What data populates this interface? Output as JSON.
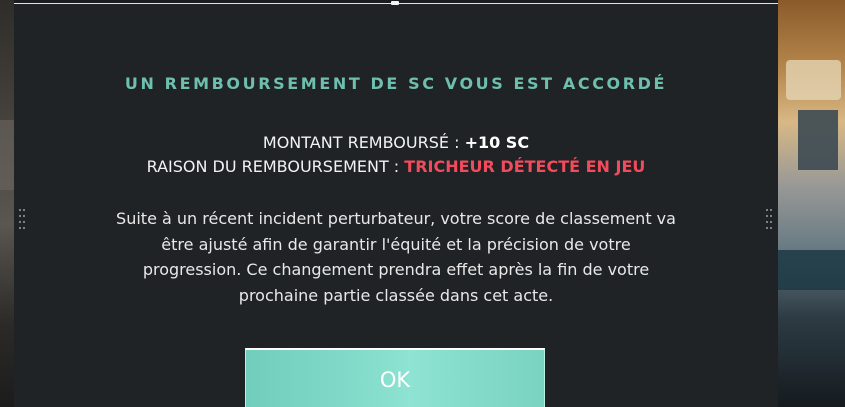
{
  "dialog": {
    "title": "UN REMBOURSEMENT DE SC VOUS EST ACCORDÉ",
    "amount_label": "MONTANT REMBOURSÉ : ",
    "amount_value": "+10 SC",
    "reason_label": "RAISON DU REMBOURSEMENT : ",
    "reason_value": "TRICHEUR DÉTECTÉ EN JEU",
    "body_lines": [
      "Suite à un récent incident perturbateur, votre score de classement va",
      "être ajusté afin de garantir l'équité et la précision de votre",
      "progression. Ce changement prendra effet après la fin de votre",
      "prochaine partie classée dans cet acte."
    ],
    "ok_label": "OK"
  },
  "colors": {
    "title": "#6fbfae",
    "reason": "#f14b5c",
    "dialog_bg": "#1f2326",
    "button": "#84dccb"
  }
}
